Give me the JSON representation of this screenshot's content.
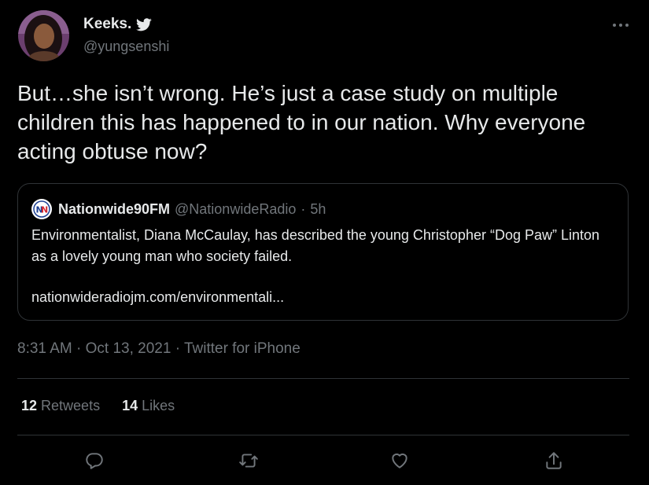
{
  "author": {
    "display_name": "Keeks.",
    "handle": "@yungsenshi",
    "verified_icon": "twitter-bird-icon"
  },
  "tweet": {
    "text": "But…she isn’t wrong. He’s just a case study on multiple children this has happened to in our nation. Why everyone acting obtuse now?"
  },
  "quote": {
    "logo_text": "NN",
    "name": "Nationwide90FM",
    "handle": "@NationwideRadio",
    "separator": "·",
    "time": "5h",
    "body": "Environmentalist, Diana McCaulay, has described the young Christopher “Dog Paw” Linton as a lovely young man who society failed.",
    "link": "nationwideradiojm.com/environmentali..."
  },
  "meta": {
    "time": "8:31 AM",
    "sep1": "·",
    "date": "Oct 13, 2021",
    "sep2": "·",
    "source": "Twitter for iPhone"
  },
  "stats": {
    "retweets_count": "12",
    "retweets_label": "Retweets",
    "likes_count": "14",
    "likes_label": "Likes"
  },
  "actions": [
    "reply-icon",
    "retweet-icon",
    "like-icon",
    "share-icon"
  ],
  "colors": {
    "background": "#000000",
    "text": "#e7e9ea",
    "muted": "#71767b",
    "border": "#2f3336"
  }
}
